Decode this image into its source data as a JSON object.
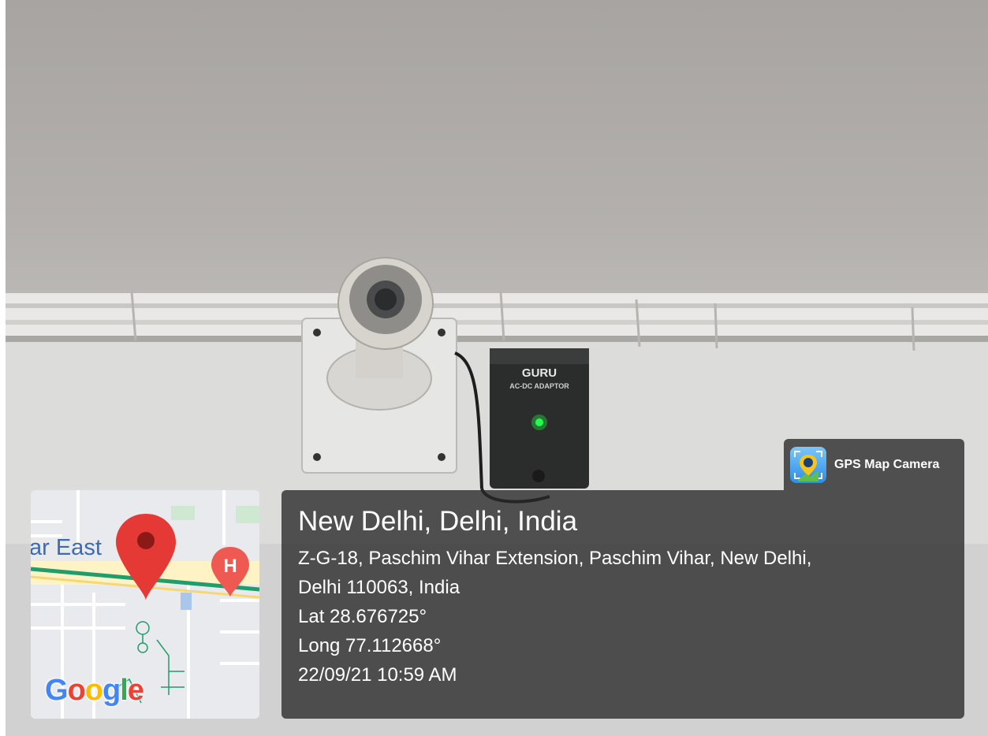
{
  "overlay": {
    "app_name": "GPS Map Camera",
    "location_title": "New Delhi, Delhi, India",
    "address_line1": "Z-G-18, Paschim Vihar Extension, Paschim Vihar, New Delhi,",
    "address_line2": "Delhi 110063, India",
    "latitude": "Lat 28.676725°",
    "longitude": "Long 77.112668°",
    "datetime": "22/09/21 10:59 AM"
  },
  "map": {
    "street_label": "ar East",
    "hospital_marker": "H",
    "brand": {
      "letters": [
        "G",
        "o",
        "o",
        "g",
        "l",
        "e"
      ]
    },
    "pin_color": "#e53935",
    "hospital_color": "#ee5a52"
  },
  "device": {
    "adaptor_brand": "GURU",
    "adaptor_label": "AC-DC ADAPTOR",
    "led_color": "#22ff4a"
  },
  "icons": {
    "app_icon": "gps-map-camera-icon",
    "location_pin": "location-pin-icon",
    "hospital": "hospital-marker-icon"
  }
}
